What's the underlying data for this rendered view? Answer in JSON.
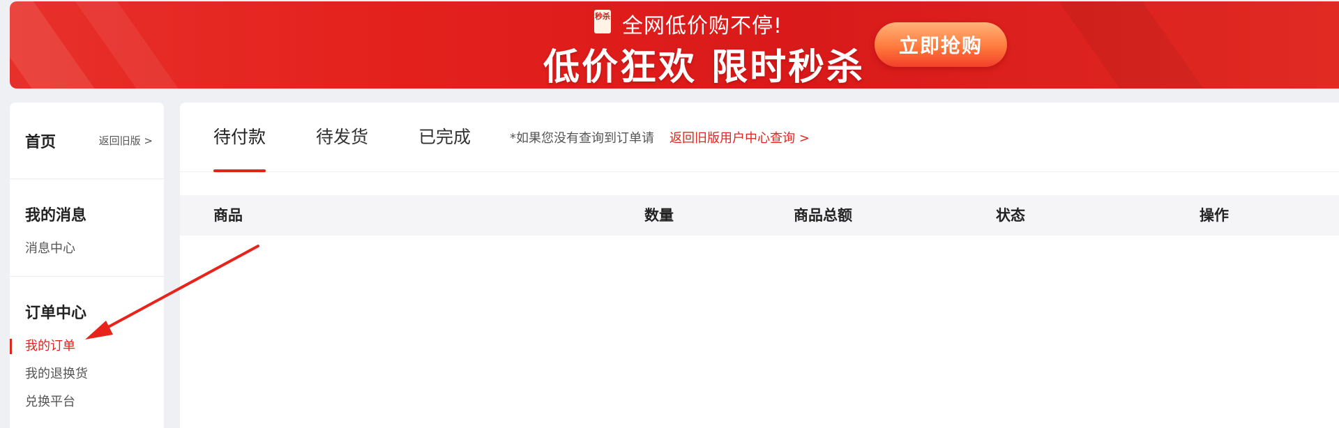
{
  "banner": {
    "badge": "秒杀",
    "slogan": "全网低价购不停!",
    "headline": "低价狂欢 限时秒杀",
    "cta": "立即抢购"
  },
  "sidebar": {
    "home": {
      "title": "首页",
      "back_link": "返回旧版 >"
    },
    "messages": {
      "title": "我的消息",
      "items": [
        "消息中心"
      ]
    },
    "orders": {
      "title": "订单中心",
      "items": [
        "我的订单",
        "我的退换货",
        "兑换平台"
      ],
      "active_index": 0
    }
  },
  "main": {
    "tabs": [
      {
        "label": "待付款",
        "active": true
      },
      {
        "label": "待发货",
        "active": false
      },
      {
        "label": "已完成",
        "active": false
      }
    ],
    "note": "*如果您没有查询到订单请",
    "note_link": "返回旧版用户中心查询 >",
    "table_headers": [
      "商品",
      "数量",
      "商品总额",
      "状态",
      "操作"
    ]
  },
  "colors": {
    "accent": "#e0261c",
    "banner": "#e3201c"
  }
}
